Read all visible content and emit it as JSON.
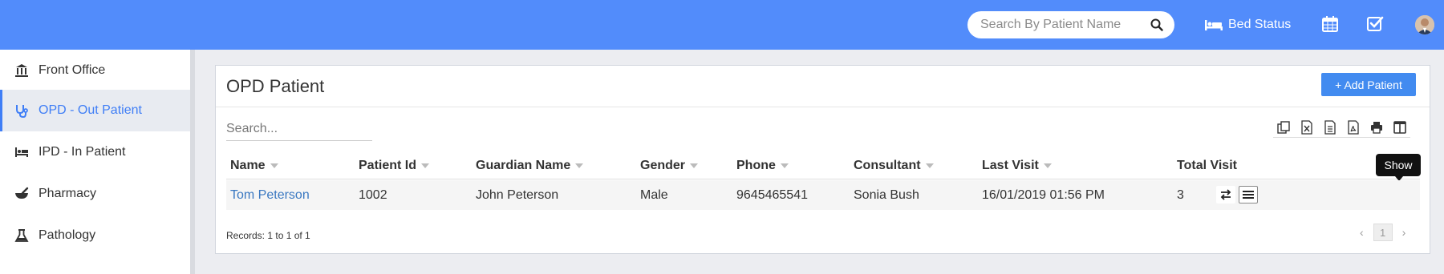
{
  "header": {
    "search_placeholder": "Search By Patient Name",
    "bed_status_label": "Bed Status",
    "icons": [
      "search-icon",
      "bed-icon",
      "calendar-icon",
      "task-check-icon",
      "user-avatar"
    ],
    "accent_color": "#528cfb"
  },
  "sidebar": {
    "items": [
      {
        "label": "Front Office",
        "icon": "front-office-icon",
        "active": false
      },
      {
        "label": "OPD - Out Patient",
        "icon": "stethoscope-icon",
        "active": true
      },
      {
        "label": "IPD - In Patient",
        "icon": "bed-icon",
        "active": false
      },
      {
        "label": "Pharmacy",
        "icon": "mortar-pestle-icon",
        "active": false
      },
      {
        "label": "Pathology",
        "icon": "flask-icon",
        "active": false
      }
    ],
    "active_color": "#3f7ef6"
  },
  "panel": {
    "title": "OPD Patient",
    "add_button": "+ Add Patient",
    "search_placeholder": "Search...",
    "export_icons": [
      "copy-icon",
      "excel-icon",
      "csv-icon",
      "pdf-icon",
      "print-icon",
      "columns-icon"
    ]
  },
  "table": {
    "columns": [
      "Name",
      "Patient Id",
      "Guardian Name",
      "Gender",
      "Phone",
      "Consultant",
      "Last Visit",
      "Total Visit"
    ],
    "rows": [
      {
        "name": "Tom Peterson",
        "patient_id": "1002",
        "guardian_name": "John Peterson",
        "gender": "Male",
        "phone": "9645465541",
        "consultant": "Sonia Bush",
        "last_visit": "16/01/2019 01:56 PM",
        "total_visit": "3"
      }
    ],
    "tooltip": "Show",
    "records_text": "Records: 1 to 1 of 1",
    "pagination": {
      "prev": "‹",
      "current": "1",
      "next": "›"
    }
  }
}
